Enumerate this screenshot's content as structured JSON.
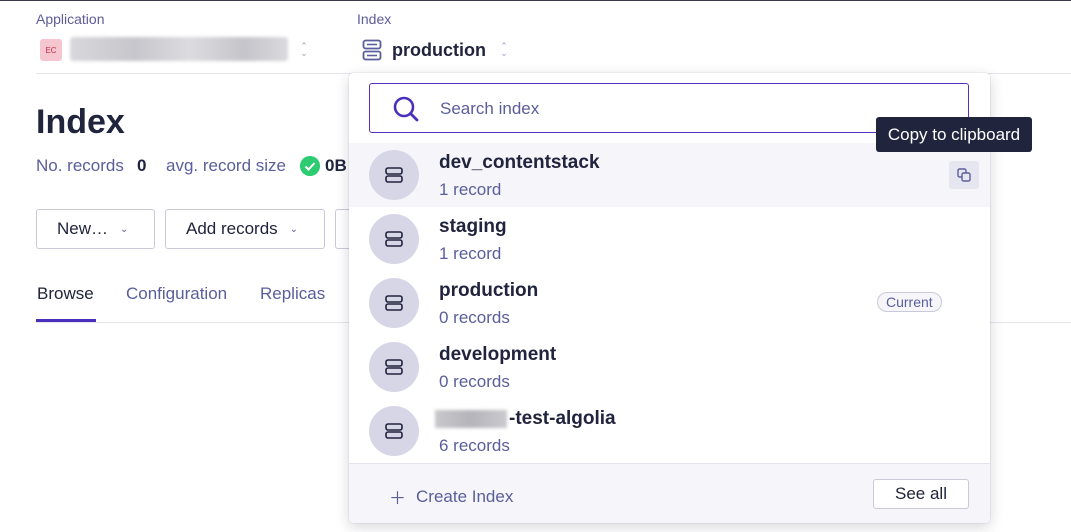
{
  "header": {
    "application_label": "Application",
    "app_badge": "EC",
    "index_label": "Index",
    "index_name": "production"
  },
  "page": {
    "title": "Index",
    "records_label": "No. records",
    "records_value": "0",
    "avg_size_label": "avg. record size",
    "avg_size_value": "0B"
  },
  "toolbar": {
    "new_label": "New…",
    "add_records_label": "Add records"
  },
  "tabs": [
    {
      "label": "Browse"
    },
    {
      "label": "Configuration"
    },
    {
      "label": "Replicas"
    }
  ],
  "dropdown": {
    "search_placeholder": "Search index",
    "items": [
      {
        "name": "dev_contentstack",
        "count": "1 record"
      },
      {
        "name": "staging",
        "count": "1 record"
      },
      {
        "name": "production",
        "count": "0 records",
        "badge": "Current"
      },
      {
        "name": "development",
        "count": "0 records"
      },
      {
        "name": "-test-algolia",
        "count": "6 records"
      }
    ],
    "create_label": "Create Index",
    "see_all_label": "See all"
  },
  "tooltip": "Copy to clipboard",
  "icons": {
    "index": "database-icon",
    "search": "search-icon",
    "copy": "copy-icon",
    "check": "check-icon"
  },
  "colors": {
    "accent": "#5a2fc0",
    "text": "#21243d",
    "muted": "#5a5e9a",
    "success": "#2ecc71"
  }
}
